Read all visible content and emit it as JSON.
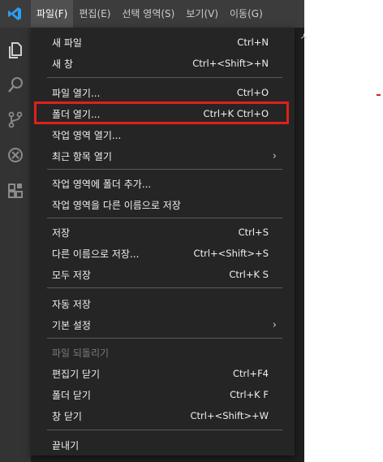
{
  "menubar": {
    "items": [
      {
        "label": "파일(F)"
      },
      {
        "label": "편집(E)"
      },
      {
        "label": "선택 영역(S)"
      },
      {
        "label": "보기(V)"
      },
      {
        "label": "이동(G)"
      }
    ]
  },
  "file_menu": {
    "new_file": {
      "label": "새 파일",
      "shortcut": "Ctrl+N"
    },
    "new_window": {
      "label": "새 창",
      "shortcut": "Ctrl+<Shift>+N"
    },
    "open_file": {
      "label": "파일 열기...",
      "shortcut": "Ctrl+O"
    },
    "open_folder": {
      "label": "폴더 열기...",
      "shortcut": "Ctrl+K Ctrl+O"
    },
    "open_workspace": {
      "label": "작업 영역 열기..."
    },
    "open_recent": {
      "label": "최근 항목 열기",
      "chevron": "›"
    },
    "add_folder_to_workspace": {
      "label": "작업 영역에 폴더 추가..."
    },
    "save_workspace_as": {
      "label": "작업 영역을 다른 이름으로 저장"
    },
    "save": {
      "label": "저장",
      "shortcut": "Ctrl+S"
    },
    "save_as": {
      "label": "다른 이름으로 저장...",
      "shortcut": "Ctrl+<Shift>+S"
    },
    "save_all": {
      "label": "모두 저장",
      "shortcut": "Ctrl+K S"
    },
    "auto_save": {
      "label": "자동 저장"
    },
    "preferences": {
      "label": "기본 설정",
      "chevron": "›"
    },
    "revert_file": {
      "label": "파일 되돌리기"
    },
    "close_editor": {
      "label": "편집기 닫기",
      "shortcut": "Ctrl+F4"
    },
    "close_folder": {
      "label": "폴더 닫기",
      "shortcut": "Ctrl+K F"
    },
    "close_window": {
      "label": "창 닫기",
      "shortcut": "Ctrl+<Shift>+W"
    },
    "exit": {
      "label": "끝내기"
    }
  },
  "colors": {
    "highlight_border": "#e0201b",
    "menu_bg": "#252526",
    "titlebar_bg": "#3c3c3c",
    "activitybar_bg": "#333333"
  }
}
